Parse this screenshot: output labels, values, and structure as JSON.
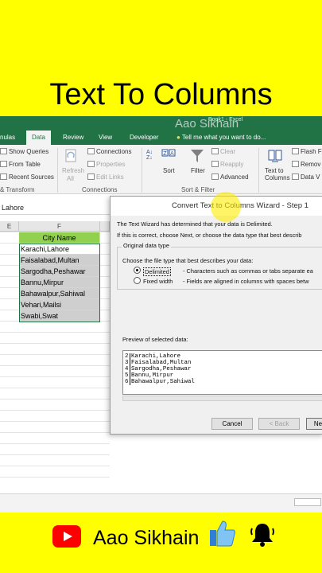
{
  "banner": {
    "title": "Text To Columns",
    "footer_name": "Aao Sikhain"
  },
  "window": {
    "title": "Book1 - Excel",
    "watermark": "Aao Sikhain"
  },
  "tabs": [
    "nulas",
    "Data",
    "Review",
    "View",
    "Developer"
  ],
  "tell_me": "Tell me what you want to do...",
  "ribbon": {
    "get_transform": {
      "show_queries": "Show Queries",
      "from_table": "From Table",
      "recent_sources": "Recent Sources",
      "group": "& Transform"
    },
    "refresh": {
      "refresh": "Refresh",
      "all": "All",
      "connections": "Connections",
      "properties": "Properties",
      "edit_links": "Edit Links",
      "group": "Connections"
    },
    "sort_filter": {
      "sort": "Sort",
      "filter": "Filter",
      "clear": "Clear",
      "reapply": "Reapply",
      "advanced": "Advanced",
      "group": "Sort & Filter"
    },
    "data_tools": {
      "text_to": "Text to",
      "columns": "Columns",
      "flash_fill": "Flash F",
      "remove": "Remov",
      "validation": "Data V"
    }
  },
  "formula_bar": {
    "value": "Lahore"
  },
  "grid": {
    "col_e": "E",
    "col_f": "F",
    "header_cell": "City Name",
    "rows": [
      "Karachi,Lahore",
      "Faisalabad,Multan",
      "Sargodha,Peshawar",
      "Bannu,Mirpur",
      "Bahawalpur,Sahiwal",
      "Vehari,Mailsi",
      "Swabi,Swat"
    ]
  },
  "dialog": {
    "title": "Convert Text to Columns Wizard - Step 1",
    "line1": "The Text Wizard has determined that your data is Delimited.",
    "line2": "If this is correct, choose Next, or choose the data type that best describ",
    "section": "Original data type",
    "choose": "Choose the file type that best describes your data:",
    "delimited": "Delimited",
    "delimited_desc": "- Characters such as commas or tabs separate ea",
    "fixed": "Fixed width",
    "fixed_desc": "- Fields are aligned in columns with spaces betw",
    "preview_label": "Preview of selected data:",
    "preview_rows": [
      {
        "n": "2",
        "text": "Karachi,Lahore"
      },
      {
        "n": "3",
        "text": "Faisalabad,Multan"
      },
      {
        "n": "4",
        "text": "Sargodha,Peshawar"
      },
      {
        "n": "5",
        "text": "Bannu,Mirpur"
      },
      {
        "n": "6",
        "text": "Bahawalpur,Sahiwal"
      }
    ],
    "cancel": "Cancel",
    "back": "< Back",
    "next": "Ne"
  },
  "colors": {
    "excel_green": "#217346",
    "banner_yellow": "#ffff00",
    "header_green": "#92d050"
  }
}
